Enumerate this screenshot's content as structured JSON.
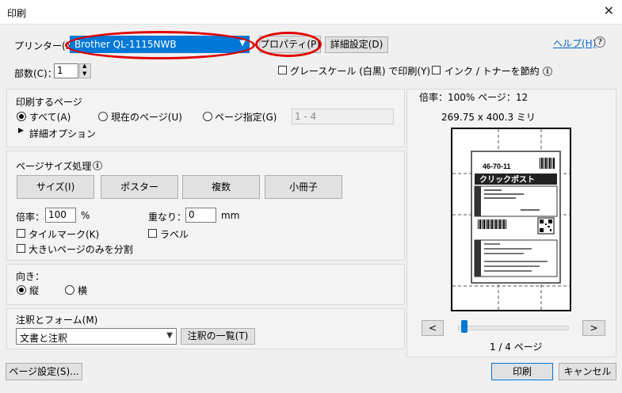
{
  "window": {
    "title": "印刷",
    "close_glyph": "✕"
  },
  "printer": {
    "label": "プリンター(N)",
    "selected": "Brother QL-1115NWB",
    "properties_button": "プロパティ(P)",
    "advanced_button": "詳細設定(D)",
    "help_link": "ヘルプ(H)",
    "help_glyph": "?",
    "copies_label": "部数(C)：",
    "copies_value": "1",
    "grayscale_label": "グレースケール (白黒) で印刷(Y)",
    "save_ink_label": "インク / トナーを節約"
  },
  "pages_to_print": {
    "heading": "印刷するページ",
    "all_label": "すべて(A)",
    "current_label": "現在のページ(U)",
    "range_label": "ページ指定(G)",
    "range_value": "1 - 4",
    "more_options": "詳細オプション"
  },
  "page_sizing": {
    "heading": "ページサイズ処理",
    "tabs": [
      "サイズ(I)",
      "ポスター",
      "複数",
      "小冊子"
    ],
    "scale_label": "倍率：",
    "scale_value": "100",
    "scale_unit": "%",
    "overlap_label": "重なり：",
    "overlap_value": "0",
    "overlap_unit": "mm",
    "tile_marks_label": "タイルマーク(K)",
    "labels_label": "ラベル",
    "split_large_label": "大きいページのみを分割"
  },
  "orientation": {
    "heading": "向き：",
    "portrait_label": "縦",
    "landscape_label": "横"
  },
  "comments": {
    "heading": "注釈とフォーム(M)",
    "selected": "文書と注釈",
    "summarize_button": "注釈の一覧(T)"
  },
  "preview": {
    "header": "倍率：100% ページ：12",
    "dimensions": "269.75 x 400.3 ミリ",
    "page_indicator": "1 / 4 ページ",
    "prev_glyph": "<",
    "next_glyph": ">",
    "label_postal_code": "46-70-11",
    "label_brand": "クリックポスト",
    "slider_position_fraction": 0.03
  },
  "footer": {
    "page_setup_button": "ページ設定(S)...",
    "print_button": "印刷",
    "cancel_button": "キャンセル"
  },
  "colors": {
    "highlight_blue": "#0078d7",
    "annotation_red": "#e00000",
    "link_blue": "#0066cc"
  }
}
